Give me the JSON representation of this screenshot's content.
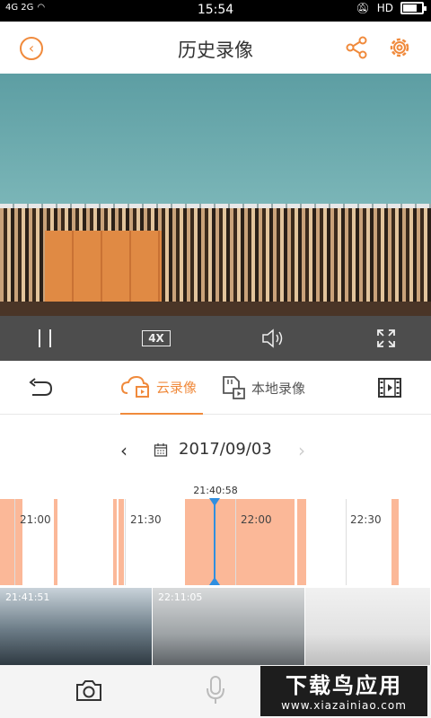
{
  "status_bar": {
    "signal_text": "4G 2G",
    "time": "15:54",
    "right_text": "HD"
  },
  "header": {
    "title": "历史录像",
    "back_icon": "chevron-left-icon",
    "share_icon": "share-icon",
    "settings_icon": "gear-icon",
    "accent_color": "#f08a3c"
  },
  "playback_controls": {
    "speed_label": "4X"
  },
  "tabs": {
    "cloud_label": "云录像",
    "local_label": "本地录像",
    "active": "cloud"
  },
  "date_selector": {
    "date": "2017/09/03",
    "prev_label": "‹",
    "next_label": "›"
  },
  "timeline": {
    "cursor_time": "21:40:58",
    "ticks": [
      "21:00",
      "21:30",
      "22:00",
      "22:30"
    ]
  },
  "thumbnails": [
    {
      "time": "21:41:51"
    },
    {
      "time": "22:11:05"
    },
    {
      "time": ""
    }
  ],
  "watermark": {
    "line1": "下载鸟应用",
    "line2": "www.xiazainiao.com"
  }
}
